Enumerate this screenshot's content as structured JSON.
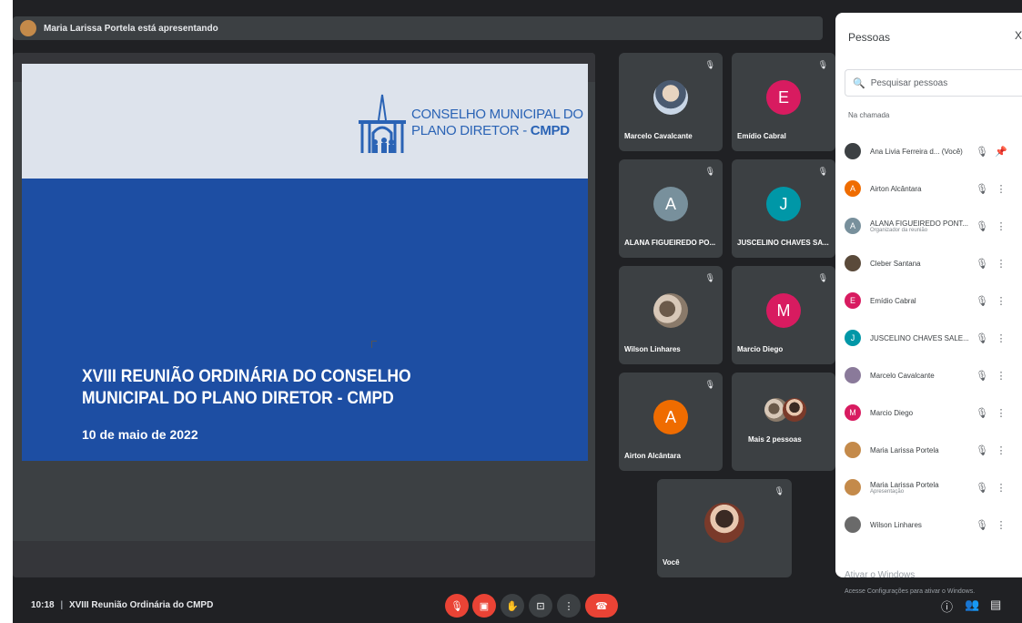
{
  "banner": {
    "presenting_text": "Maria Larissa Portela está apresentando"
  },
  "slide": {
    "logo_line1": "CONSELHO MUNICIPAL DO",
    "logo_line2a": "PLANO DIRETOR - ",
    "logo_line2b": "CMPD",
    "title_line1": "XVIII REUNIÃO ORDINÁRIA DO CONSELHO",
    "title_line2": "MUNICIPAL DO PLANO DIRETOR - CMPD",
    "date": "10 de maio de 2022"
  },
  "tiles": [
    {
      "name": "Marcelo Cavalcante",
      "initial": "",
      "color": ""
    },
    {
      "name": "Emídio Cabral",
      "initial": "E",
      "color": "#d81b60"
    },
    {
      "name": "ALANA FIGUEIREDO PO...",
      "initial": "A",
      "color": "#78909c"
    },
    {
      "name": "JUSCELINO CHAVES SA...",
      "initial": "J",
      "color": "#0097a7"
    },
    {
      "name": "Wilson Linhares",
      "initial": "",
      "color": ""
    },
    {
      "name": "Marcio Diego",
      "initial": "M",
      "color": "#d81b60"
    },
    {
      "name": "Airton Alcântara",
      "initial": "A",
      "color": "#ef6c00"
    },
    {
      "name": "Mais 2 pessoas",
      "initial": "",
      "color": ""
    },
    {
      "name": "Você",
      "initial": "",
      "color": ""
    }
  ],
  "people_panel": {
    "title": "Pessoas",
    "close": "X",
    "search_placeholder": "Pesquisar pessoas",
    "section": "Na chamada",
    "people": [
      {
        "name": "Ana Livia Ferreira d... (Você)",
        "sub": "",
        "initial": "",
        "color": "#3c4043"
      },
      {
        "name": "Airton Alcântara",
        "sub": "",
        "initial": "A",
        "color": "#ef6c00"
      },
      {
        "name": "ALANA FIGUEIREDO PONT...",
        "sub": "Organizador da reunião",
        "initial": "A",
        "color": "#78909c"
      },
      {
        "name": "Cleber Santana",
        "sub": "",
        "initial": "",
        "color": "#5a4a3a"
      },
      {
        "name": "Emídio Cabral",
        "sub": "",
        "initial": "E",
        "color": "#d81b60"
      },
      {
        "name": "JUSCELINO CHAVES SALE...",
        "sub": "",
        "initial": "J",
        "color": "#0097a7"
      },
      {
        "name": "Marcelo Cavalcante",
        "sub": "",
        "initial": "",
        "color": "#8a7a9a"
      },
      {
        "name": "Marcio Diego",
        "sub": "",
        "initial": "M",
        "color": "#d81b60"
      },
      {
        "name": "Maria Larissa Portela",
        "sub": "",
        "initial": "",
        "color": "#c48a4a"
      },
      {
        "name": "Maria Larissa Portela",
        "sub": "Apresentação",
        "initial": "",
        "color": "#c48a4a"
      },
      {
        "name": "Wilson Linhares",
        "sub": "",
        "initial": "",
        "color": "#6a6a6a"
      }
    ]
  },
  "bottombar": {
    "time": "10:18",
    "separator": "|",
    "meeting_title": "XVIII Reunião Ordinária do CMPD"
  },
  "watermark": {
    "line1": "Ativar o Windows",
    "line2": "Acesse Configurações para ativar o Windows."
  }
}
